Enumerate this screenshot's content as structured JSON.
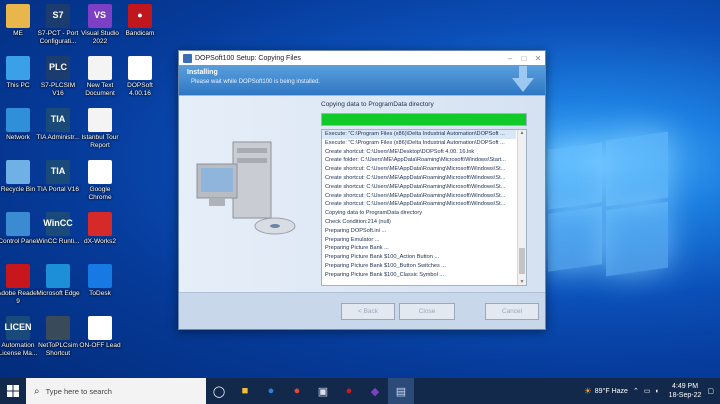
{
  "desktop_icons": [
    {
      "label": "ME",
      "color": "#e8b64a",
      "glyph": ""
    },
    {
      "label": "S7-PCT - Port Configurati...",
      "color": "#1c3b6e",
      "glyph": "S7"
    },
    {
      "label": "Visual Studio 2022",
      "color": "#7d3fc4",
      "glyph": "VS"
    },
    {
      "label": "Bandicam",
      "color": "#c0161e",
      "glyph": "●"
    },
    {
      "label": "This PC",
      "color": "#3aa0e8",
      "glyph": ""
    },
    {
      "label": "S7-PLCSIM V16",
      "color": "#1c3b6e",
      "glyph": "PLC"
    },
    {
      "label": "New Text Document",
      "color": "#f4f4f4",
      "glyph": ""
    },
    {
      "label": "DOPSoft 4.00.16",
      "color": "#ffffff",
      "glyph": ""
    },
    {
      "label": "Network",
      "color": "#2f8fd8",
      "glyph": ""
    },
    {
      "label": "TIA Administr...",
      "color": "#1a4a7a",
      "glyph": "TIA"
    },
    {
      "label": "Istanbul Tour Report",
      "color": "#f4f4f4",
      "glyph": ""
    },
    {
      "label": "Recycle Bin",
      "color": "#6fb1e4",
      "glyph": ""
    },
    {
      "label": "TIA Portal V16",
      "color": "#1a4a7a",
      "glyph": "TIA"
    },
    {
      "label": "Google Chrome",
      "color": "#ffffff",
      "glyph": ""
    },
    {
      "label": "Control Panel",
      "color": "#3b8bd2",
      "glyph": ""
    },
    {
      "label": "WinCC Runti...",
      "color": "#1a4a7a",
      "glyph": "WinCC"
    },
    {
      "label": "dX-Works2",
      "color": "#d62a2a",
      "glyph": ""
    },
    {
      "label": "Adobe Reader 9",
      "color": "#c8161d",
      "glyph": ""
    },
    {
      "label": "Microsoft Edge",
      "color": "#1d8fd8",
      "glyph": ""
    },
    {
      "label": "ToDesk",
      "color": "#1779e3",
      "glyph": ""
    },
    {
      "label": "Automation License Ma...",
      "color": "#1a4a7a",
      "glyph": "LICEN"
    },
    {
      "label": "NetToPLCsim Shortcut",
      "color": "#394b5a",
      "glyph": ""
    },
    {
      "label": "ON-OFF Lead",
      "color": "#ffffff",
      "glyph": ""
    }
  ],
  "window": {
    "title": "DOPSoft100 Setup: Copying Files",
    "header_title": "Installing",
    "header_sub": "Please wait while DOPSoft100 is being installed.",
    "status": "Copying data to ProgramData directory",
    "progress": 1.0,
    "log_lines": [
      "Execute: \"C:\\Program Files (x86)\\Delta Industrial Automation\\DOPSoft ...",
      "Execute: \"C:\\Program Files (x86)\\Delta Industrial Automation\\DOPSoft ...",
      "Create shortcut: C:\\Users\\ME\\Desktop\\DOPSoft 4.00. 16.lnk",
      "Create folder: C:\\Users\\ME\\AppData\\Roaming\\Microsoft\\Windows\\Start...",
      "Create shortcut: C:\\Users\\ME\\AppData\\Roaming\\Microsoft\\Windows\\St...",
      "Create shortcut: C:\\Users\\ME\\AppData\\Roaming\\Microsoft\\Windows\\St...",
      "Create shortcut: C:\\Users\\ME\\AppData\\Roaming\\Microsoft\\Windows\\St...",
      "Create shortcut: C:\\Users\\ME\\AppData\\Roaming\\Microsoft\\Windows\\St...",
      "Create shortcut: C:\\Users\\ME\\AppData\\Roaming\\Microsoft\\Windows\\St...",
      "Copying data to ProgramData directory",
      "Check Condition:214 (null)",
      "Preparing DOPSoft.ini ...",
      "Preparing Emulator ...",
      "Preparing Picture Bank ...",
      "Preparing Picture Bank $100_Action Button ...",
      "Preparing Picture Bank $100_Button Switches ...",
      "Preparing Picture Bank $100_Classic Symbol ..."
    ],
    "buttons": {
      "back": "< Back",
      "close": "Close",
      "cancel": "Cancel"
    }
  },
  "taskbar": {
    "search_placeholder": "Type here to search",
    "weather": "89°F  Haze",
    "time": "4:49 PM",
    "date": "18-Sep-22"
  }
}
